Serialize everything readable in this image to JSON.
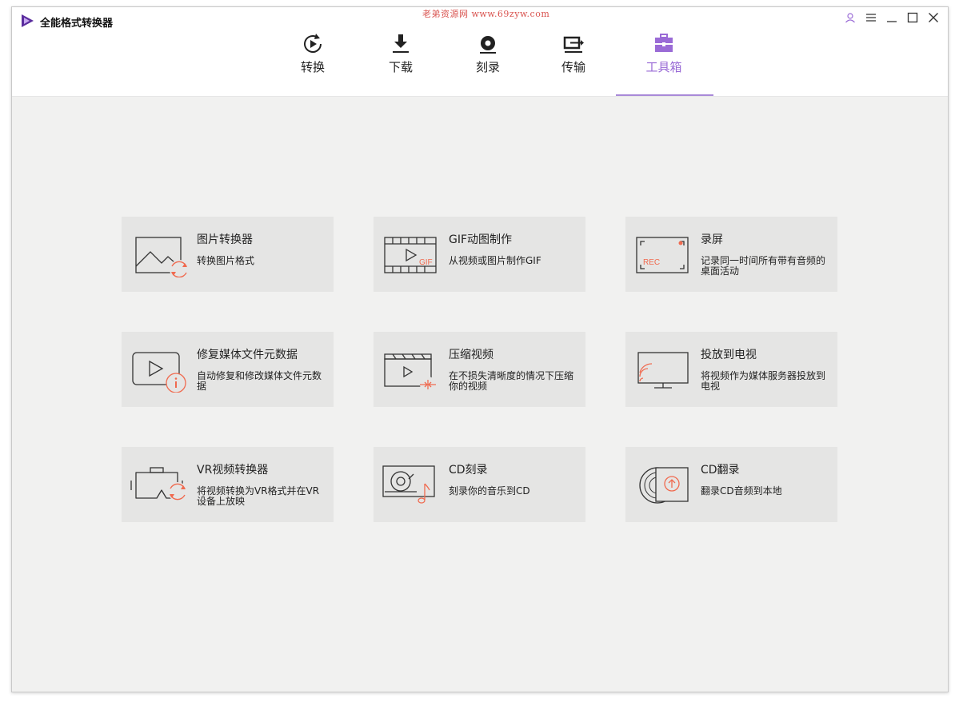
{
  "app": {
    "title": "全能格式转换器",
    "watermark": "老弟资源网 www.69zyw.com"
  },
  "nav": {
    "tabs": [
      {
        "label": "转换"
      },
      {
        "label": "下载"
      },
      {
        "label": "刻录"
      },
      {
        "label": "传输"
      },
      {
        "label": "工具箱"
      }
    ],
    "active": "工具箱"
  },
  "tools": [
    {
      "title": "图片转换器",
      "desc": "转换图片格式",
      "icon": "image-convert-icon"
    },
    {
      "title": "GIF动图制作",
      "desc": "从视频或图片制作GIF",
      "icon": "gif-maker-icon",
      "badge": "GIF"
    },
    {
      "title": "录屏",
      "desc": "记录同一时间所有带有音频的桌面活动",
      "icon": "screen-record-icon",
      "badge": "REC"
    },
    {
      "title": "修复媒体文件元数据",
      "desc": "自动修复和修改媒体文件元数据",
      "icon": "metadata-fix-icon"
    },
    {
      "title": "压缩视频",
      "desc": "在不损失清晰度的情况下压缩你的视频",
      "icon": "compress-video-icon"
    },
    {
      "title": "投放到电视",
      "desc": "将视频作为媒体服务器投放到电视",
      "icon": "cast-tv-icon"
    },
    {
      "title": "VR视频转换器",
      "desc": "将视频转换为VR格式并在VR设备上放映",
      "icon": "vr-convert-icon"
    },
    {
      "title": "CD刻录",
      "desc": "刻录你的音乐到CD",
      "icon": "cd-burn-icon"
    },
    {
      "title": "CD翻录",
      "desc": "翻录CD音频到本地",
      "icon": "cd-rip-icon"
    }
  ],
  "colors": {
    "accent": "#9a6bd6",
    "icon_accent": "#f06a4f",
    "card_bg": "#e5e5e4"
  }
}
